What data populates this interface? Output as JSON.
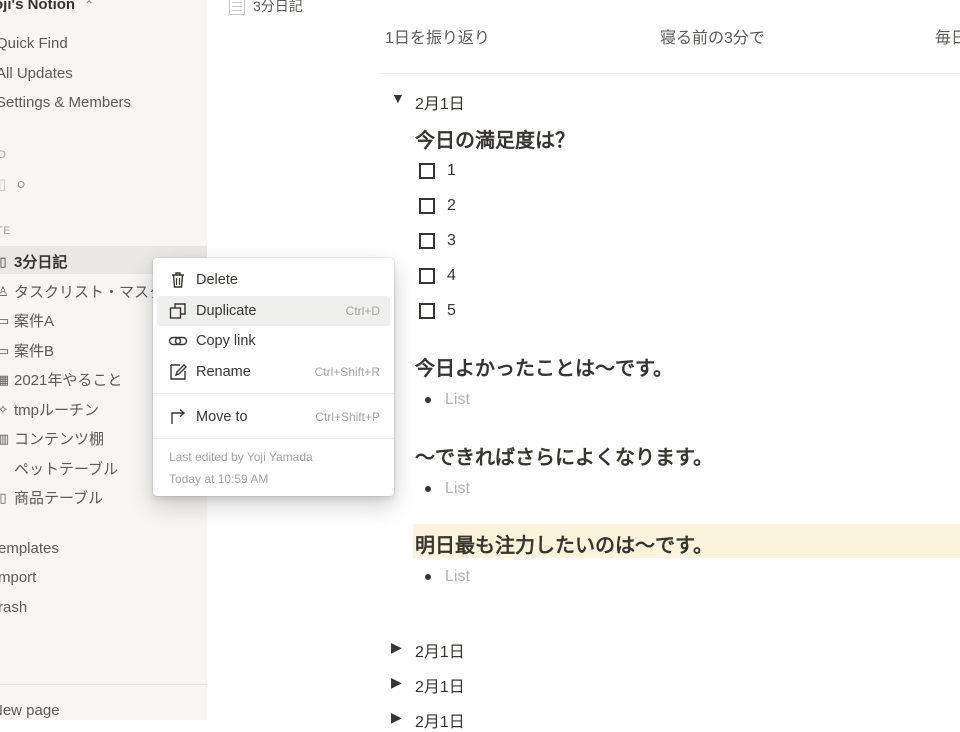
{
  "sidebar": {
    "workspace": "oji's Notion",
    "nav": [
      "Quick Find",
      "All Updates",
      "Settings & Members"
    ],
    "favorites_heading": "D",
    "favorite_item": "○",
    "private_heading": "TE",
    "pages": [
      {
        "label": "3分日記",
        "icon": "page-icon",
        "glyph": "▯"
      },
      {
        "label": "タスクリスト・マスク",
        "icon": "person-icon",
        "glyph": "♙"
      },
      {
        "label": "案件A",
        "icon": "folder-icon",
        "glyph": "▭"
      },
      {
        "label": "案件B",
        "icon": "folder-icon",
        "glyph": "▭"
      },
      {
        "label": "2021年やること",
        "icon": "calendar-icon",
        "glyph": "▦"
      },
      {
        "label": "tmpルーチン",
        "icon": "bulb-icon",
        "glyph": "✧"
      },
      {
        "label": "コンテンツ棚",
        "icon": "books-icon",
        "glyph": "▥"
      },
      {
        "label": "ペットテーブル",
        "icon": "paw-icon",
        "glyph": " "
      },
      {
        "label": "商品テーブル",
        "icon": "bag-icon",
        "glyph": "▯"
      }
    ],
    "bottom": [
      "emplates",
      "mport",
      "rash"
    ],
    "new_page": "New page"
  },
  "main": {
    "breadcrumb": "3分日記",
    "columns": [
      "1日を振り返り",
      "寝る前の3分で",
      "毎日"
    ],
    "toggle_date": "2月1日",
    "h1": "今日の満足度は？",
    "todos": [
      "1",
      "2",
      "3",
      "4",
      "5"
    ],
    "h2": "今日よかったことは〜です。",
    "h3": "〜できればさらによくなります。",
    "h4": "明日最も注力したいのは〜です。",
    "list_placeholder": "List",
    "collapsed": [
      "2月1日",
      "2月1日",
      "2月1日"
    ]
  },
  "menu": {
    "items": [
      {
        "label": "Delete",
        "shortcut": ""
      },
      {
        "label": "Duplicate",
        "shortcut": "Ctrl+D"
      },
      {
        "label": "Copy link",
        "shortcut": ""
      },
      {
        "label": "Rename",
        "shortcut": "Ctrl+Shift+R"
      },
      {
        "label": "Move to",
        "shortcut": "Ctrl+Shift+P"
      }
    ],
    "last_edited": "Last edited by Yoji Yamada",
    "edited_time": "Today at 10:59 AM"
  },
  "colors": {
    "sidebar_bg": "#f7f6f3",
    "highlight": "#fbf3db",
    "menu_hover": "#efefee"
  }
}
